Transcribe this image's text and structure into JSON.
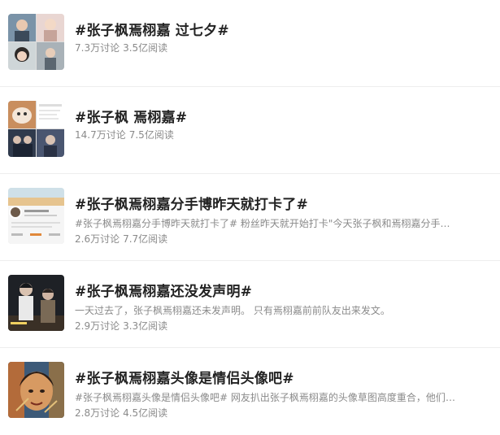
{
  "topics": [
    {
      "title": "#张子枫焉栩嘉 过七夕#",
      "desc": "",
      "discussions": "7.3万讨论",
      "reads": "3.5亿阅读",
      "thumb_icon": "collage-photos-icon"
    },
    {
      "title": "#张子枫 焉栩嘉#",
      "desc": "",
      "discussions": "14.7万讨论",
      "reads": "7.5亿阅读",
      "thumb_icon": "collage-screenshot-icon"
    },
    {
      "title": "#张子枫焉栩嘉分手博昨天就打卡了#",
      "desc": "#张子枫焉栩嘉分手博昨天就打卡了# 粉丝昨天就开始打卡\"今天张子枫和焉栩嘉分手了...",
      "discussions": "2.6万讨论",
      "reads": "7.7亿阅读",
      "thumb_icon": "profile-page-icon"
    },
    {
      "title": "#张子枫焉栩嘉还没发声明#",
      "desc": "一天过去了，张子枫焉栩嘉还未发声明。 只有焉栩嘉前前队友出来发文。",
      "discussions": "2.9万讨论",
      "reads": "3.3亿阅读",
      "thumb_icon": "stage-photo-icon"
    },
    {
      "title": "#张子枫焉栩嘉头像是情侣头像吧#",
      "desc": "#张子枫焉栩嘉头像是情侣头像吧# 网友扒出张子枫焉栩嘉的头像草图高度重合，他们的...",
      "discussions": "2.8万讨论",
      "reads": "4.5亿阅读",
      "thumb_icon": "painting-avatar-icon"
    }
  ]
}
